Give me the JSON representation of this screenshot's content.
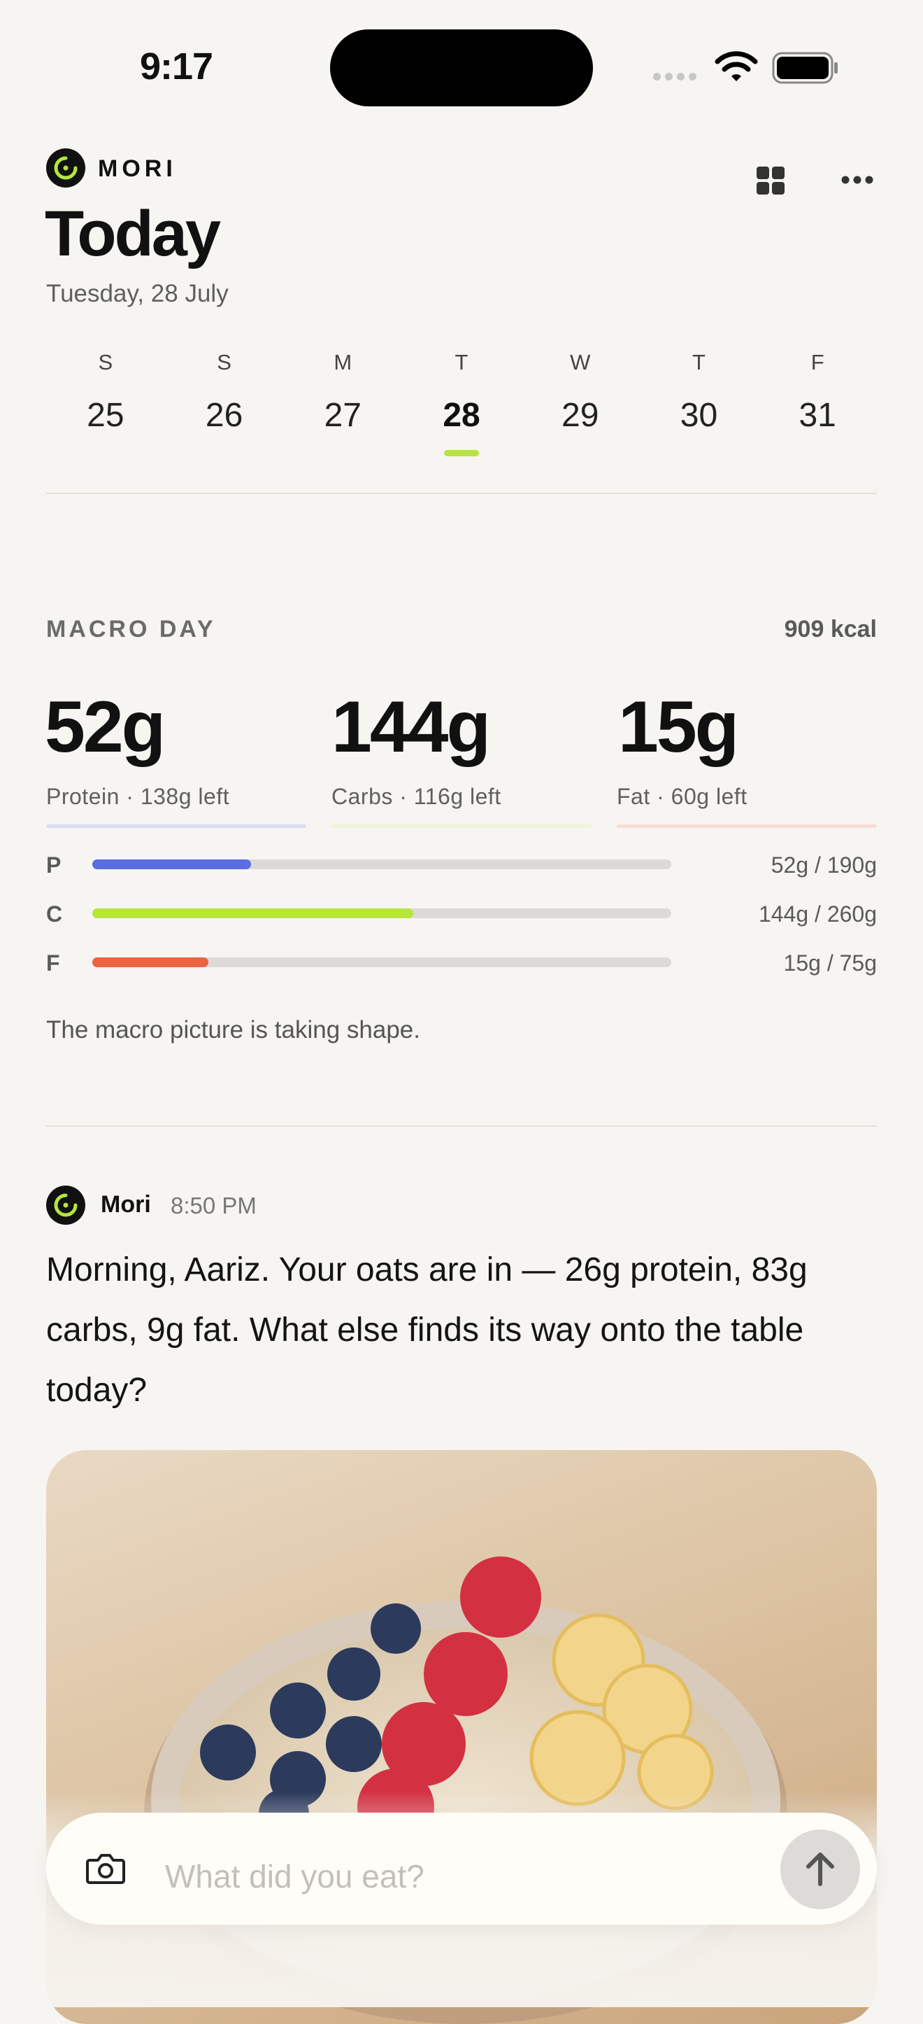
{
  "status_bar": {
    "time": "9:17"
  },
  "header": {
    "brand": "MORI",
    "title": "Today",
    "date": "Tuesday, 28 July"
  },
  "week": [
    {
      "dow": "S",
      "num": "25",
      "selected": false
    },
    {
      "dow": "S",
      "num": "26",
      "selected": false
    },
    {
      "dow": "M",
      "num": "27",
      "selected": false
    },
    {
      "dow": "T",
      "num": "28",
      "selected": true
    },
    {
      "dow": "W",
      "num": "29",
      "selected": false
    },
    {
      "dow": "T",
      "num": "30",
      "selected": false
    },
    {
      "dow": "F",
      "num": "31",
      "selected": false
    }
  ],
  "macro": {
    "label": "MACRO DAY",
    "kcal": "909 kcal",
    "protein": {
      "value": "52g",
      "sub": "Protein · 138g left"
    },
    "carbs": {
      "value": "144g",
      "sub": "Carbs · 116g left"
    },
    "fat": {
      "value": "15g",
      "sub": "Fat · 60g left"
    },
    "bars": [
      {
        "letter": "P",
        "text": "52g / 190g",
        "current": 52,
        "goal": 190,
        "color": "#5b6ee1"
      },
      {
        "letter": "C",
        "text": "144g / 260g",
        "current": 144,
        "goal": 260,
        "color": "#b5e63a"
      },
      {
        "letter": "F",
        "text": "15g / 75g",
        "current": 15,
        "goal": 75,
        "color": "#e8653f"
      }
    ],
    "note": "The macro picture is taking shape."
  },
  "chat": {
    "sender": "Mori",
    "time": "8:50 PM",
    "message": "Morning, Aariz. Your oats are in — 26g protein, 83g carbs, 9g fat. What else finds its way onto the table today?"
  },
  "composer": {
    "placeholder": "What did you eat?"
  },
  "colors": {
    "accent": "#b5e63a",
    "protein": "#5b6ee1",
    "carbs": "#b5e63a",
    "fat": "#e8653f",
    "background": "#f7f5f1"
  },
  "icons": [
    "logo-icon",
    "grid-icon",
    "more-icon",
    "camera-icon",
    "arrow-up-icon",
    "wifi-icon",
    "battery-icon"
  ]
}
